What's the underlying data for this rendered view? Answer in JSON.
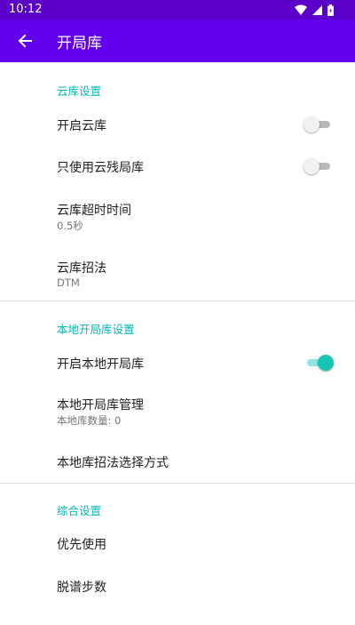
{
  "status_bar": {
    "time": "10:12",
    "icons": [
      "signal-icon",
      "wifi-icon",
      "battery-icon"
    ]
  },
  "app_bar": {
    "title": "开局库",
    "back_icon": "arrow-left-icon",
    "color": "#6200ee"
  },
  "sections": {
    "cloud": {
      "header": "云库设置",
      "items": {
        "enable_cloud": {
          "title": "开启云库",
          "switch_on": false
        },
        "only_cloud_endgame": {
          "title": "只使用云残局库",
          "switch_on": false
        },
        "cloud_timeout": {
          "title": "云库超时时间",
          "subtitle": "0.5秒"
        },
        "cloud_method": {
          "title": "云库招法",
          "subtitle": "DTM"
        }
      }
    },
    "local": {
      "header": "本地开局库设置",
      "items": {
        "enable_local": {
          "title": "开启本地开局库",
          "switch_on": true
        },
        "local_manage": {
          "title": "本地开局库管理",
          "subtitle": "本地库数量: 0"
        },
        "local_method_select": {
          "title": "本地库招法选择方式"
        }
      }
    },
    "general": {
      "header": "综合设置",
      "items": {
        "priority": {
          "title": "优先使用"
        },
        "off_book_steps": {
          "title": "脱谱步数"
        }
      }
    }
  },
  "colors": {
    "accent": "#00b8b8",
    "switch_on": "#17c6b2",
    "status_bar": "#5a00c8"
  }
}
